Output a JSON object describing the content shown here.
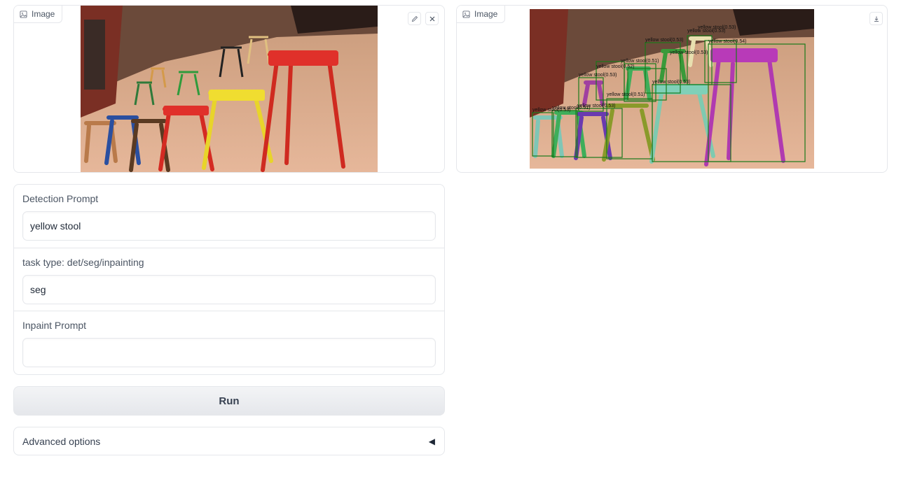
{
  "input_image": {
    "label": "Image",
    "icon": "image-icon",
    "actions": [
      "edit-icon",
      "close-icon"
    ]
  },
  "output_image": {
    "label": "Image",
    "icon": "image-icon",
    "actions": [
      "download-icon"
    ],
    "detections": [
      "yellow stool(0.53)",
      "yellow stool(0.51)",
      "yellow stool(0.53)",
      "yellow stool(0.51)",
      "yellow stool(0.53)",
      "yellow stool(0.54)",
      "yellow stool(0.53)",
      "yellow stool(0.51)",
      "yellow stool(0.52)",
      "yellow stool(0.53)",
      "yellow stool(0.53)",
      "yellow stool(0.53)",
      "yellow stool(0.53)"
    ]
  },
  "form": {
    "detection_prompt": {
      "label": "Detection Prompt",
      "value": "yellow stool"
    },
    "task_type": {
      "label": "task type: det/seg/inpainting",
      "value": "seg"
    },
    "inpaint_prompt": {
      "label": "Inpaint Prompt",
      "value": ""
    }
  },
  "run_button": {
    "label": "Run"
  },
  "advanced_options": {
    "label": "Advanced options",
    "arrow": "◀"
  },
  "colors": {
    "border": "#e5e7eb",
    "box": "#1a7a1a"
  }
}
